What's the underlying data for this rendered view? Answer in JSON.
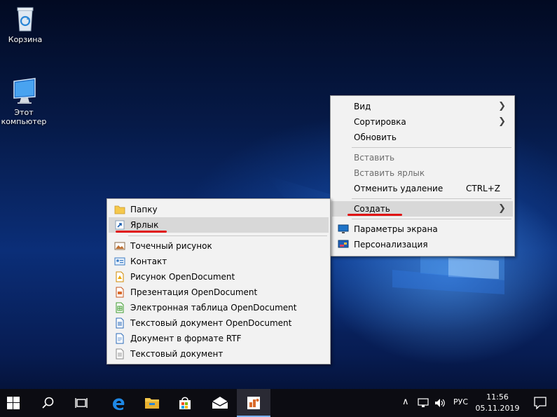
{
  "desktop": {
    "recycle_bin_label": "Корзина",
    "this_pc_label": "Этот компьютер"
  },
  "context_menu": {
    "items": [
      {
        "label": "Вид",
        "submenu": true,
        "enabled": true
      },
      {
        "label": "Сортировка",
        "submenu": true,
        "enabled": true
      },
      {
        "label": "Обновить",
        "enabled": true
      },
      {
        "label": "Вставить",
        "enabled": false
      },
      {
        "label": "Вставить ярлык",
        "enabled": false
      },
      {
        "label": "Отменить удаление",
        "shortcut": "CTRL+Z",
        "enabled": true
      },
      {
        "label": "Создать",
        "submenu": true,
        "enabled": true,
        "highlighted": true
      },
      {
        "label": "Параметры экрана",
        "icon": "display-settings-icon",
        "enabled": true
      },
      {
        "label": "Персонализация",
        "icon": "personalization-icon",
        "enabled": true
      }
    ]
  },
  "create_submenu": {
    "items": [
      {
        "label": "Папку",
        "icon": "folder-icon"
      },
      {
        "label": "Ярлык",
        "icon": "shortcut-icon",
        "highlighted": true
      },
      {
        "label": "Точечный рисунок",
        "icon": "bitmap-icon"
      },
      {
        "label": "Контакт",
        "icon": "contact-icon"
      },
      {
        "label": "Рисунок OpenDocument",
        "icon": "odg-icon"
      },
      {
        "label": "Презентация OpenDocument",
        "icon": "odp-icon"
      },
      {
        "label": "Электронная таблица OpenDocument",
        "icon": "ods-icon"
      },
      {
        "label": "Текстовый документ OpenDocument",
        "icon": "odt-icon"
      },
      {
        "label": "Документ в формате RTF",
        "icon": "rtf-icon"
      },
      {
        "label": "Текстовый документ",
        "icon": "txt-icon"
      }
    ]
  },
  "taskbar": {
    "language": "РУС",
    "time": "11:56",
    "date": "05.11.2019",
    "pinned": [
      "edge-icon",
      "file-explorer-icon",
      "store-icon",
      "mail-icon",
      "app-icon"
    ]
  },
  "colors": {
    "annotation_underline": "#e01010",
    "menu_background": "#f2f2f2",
    "menu_highlight": "#d8d8d8",
    "taskbar": "#0c0c12"
  }
}
